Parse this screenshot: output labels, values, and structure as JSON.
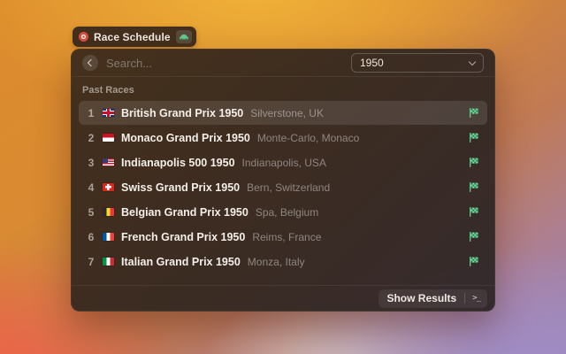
{
  "tooltip": {
    "label": "Race Schedule",
    "leading_icon": "record-dot-icon",
    "trailing_icon": "race-car-icon"
  },
  "header": {
    "back_icon": "chevron-left-icon",
    "search_placeholder": "Search...",
    "year_dropdown": {
      "value": "1950",
      "chevron_icon": "chevron-down-icon"
    }
  },
  "main": {
    "section_title": "Past Races",
    "row_trailing_icon": "checkered-flag-icon",
    "races": [
      {
        "index": "1",
        "flag": "gb",
        "flag_icon": "uk-flag-icon",
        "title": "British Grand Prix 1950",
        "location": "Silverstone, UK",
        "selected": true
      },
      {
        "index": "2",
        "flag": "mc",
        "flag_icon": "monaco-flag-icon",
        "title": "Monaco Grand Prix 1950",
        "location": "Monte-Carlo, Monaco",
        "selected": false
      },
      {
        "index": "3",
        "flag": "us",
        "flag_icon": "usa-flag-icon",
        "title": "Indianapolis 500 1950",
        "location": "Indianapolis, USA",
        "selected": false
      },
      {
        "index": "4",
        "flag": "ch",
        "flag_icon": "switzerland-flag-icon",
        "title": "Swiss Grand Prix 1950",
        "location": "Bern, Switzerland",
        "selected": false
      },
      {
        "index": "5",
        "flag": "be",
        "flag_icon": "belgium-flag-icon",
        "title": "Belgian Grand Prix 1950",
        "location": "Spa, Belgium",
        "selected": false
      },
      {
        "index": "6",
        "flag": "fr",
        "flag_icon": "france-flag-icon",
        "title": "French Grand Prix 1950",
        "location": "Reims, France",
        "selected": false
      },
      {
        "index": "7",
        "flag": "it",
        "flag_icon": "italy-flag-icon",
        "title": "Italian Grand Prix 1950",
        "location": "Monza, Italy",
        "selected": false
      }
    ]
  },
  "footer": {
    "action_label": "Show Results",
    "key_hint": ">_"
  },
  "colors": {
    "accent_green": "#63c98c",
    "checker_dark_green": "#2f7d52",
    "selected_row_highlight": "rgba(255,255,255,0.11)",
    "window_bg": "#3a2c22",
    "record_red": "#dd4b3e"
  }
}
